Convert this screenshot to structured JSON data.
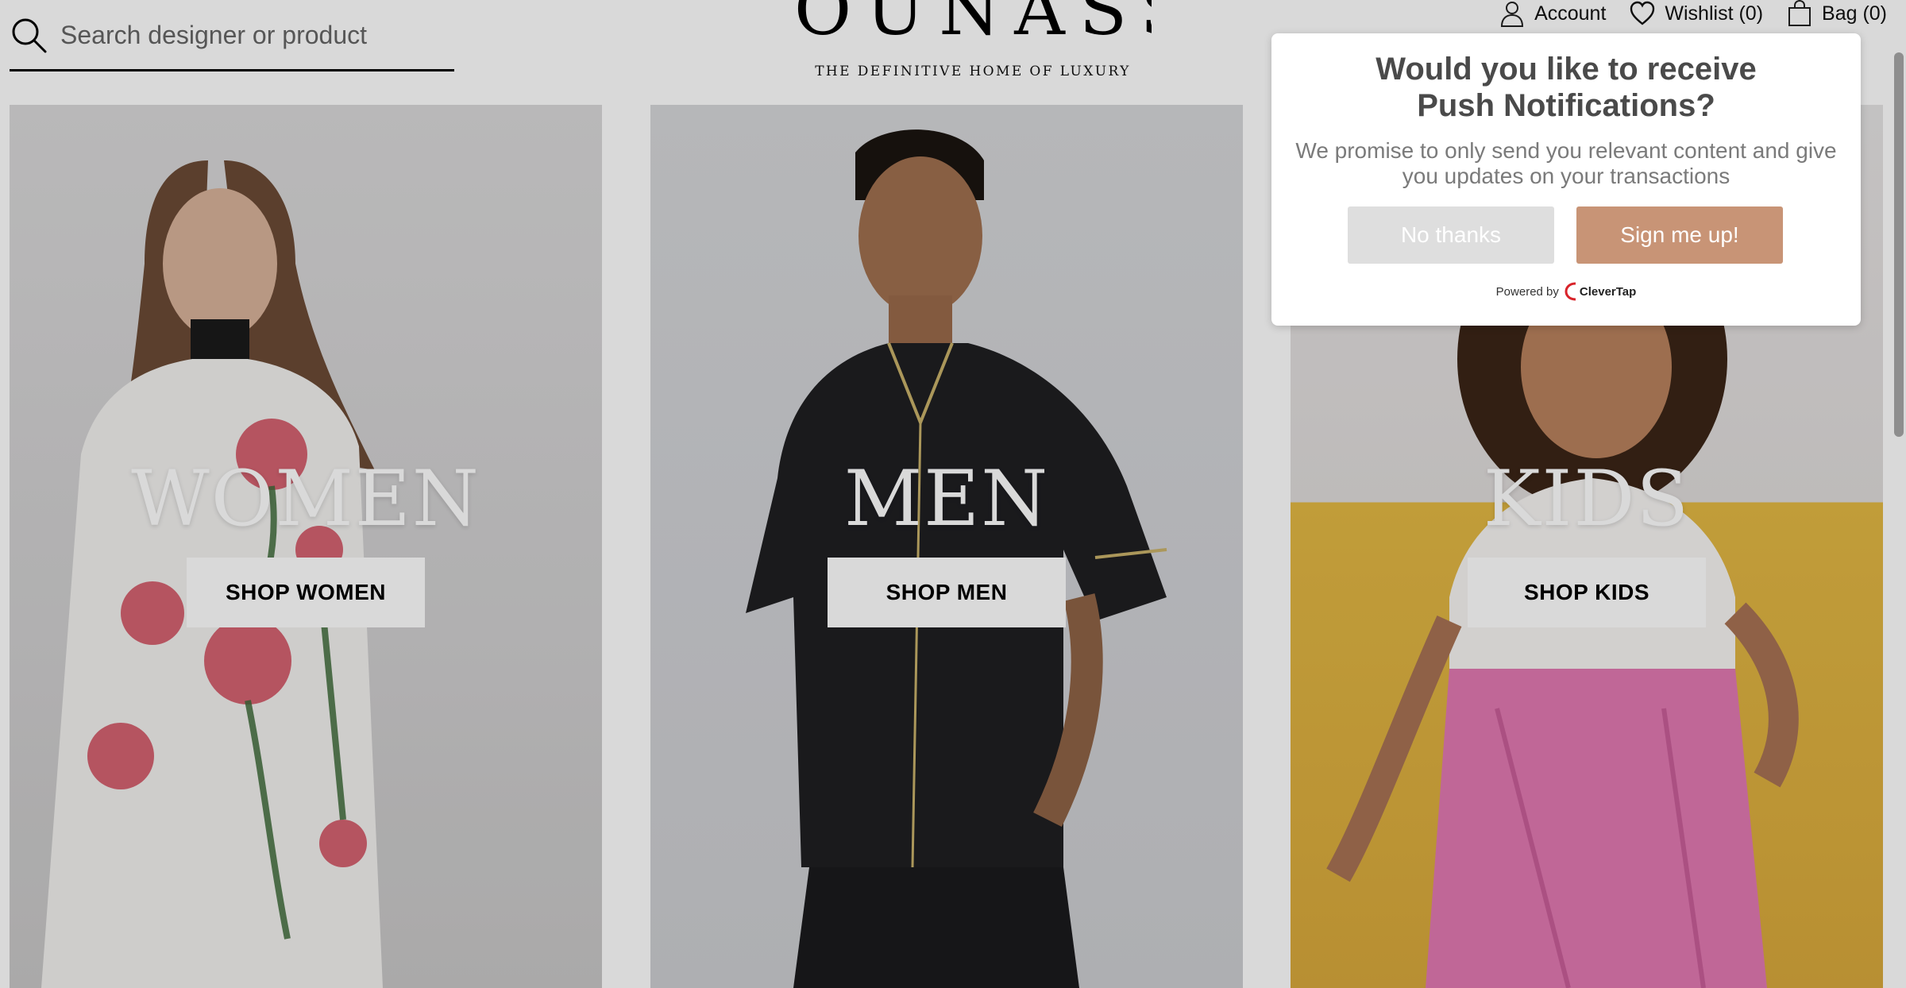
{
  "search": {
    "placeholder": "Search designer or product"
  },
  "brand": {
    "logo_text": "OUNASS",
    "tagline": "THE DEFINITIVE HOME OF LUXURY"
  },
  "nav": {
    "account_label": "Account",
    "wishlist_label": "Wishlist (0)",
    "bag_label": "Bag (0)"
  },
  "categories": [
    {
      "title": "WOMEN",
      "button_label": "SHOP WOMEN"
    },
    {
      "title": "MEN",
      "button_label": "SHOP MEN"
    },
    {
      "title": "KIDS",
      "button_label": "SHOP KIDS"
    }
  ],
  "push_modal": {
    "title_line1": "Would you like to receive",
    "title_line2": "Push Notifications?",
    "body": "We promise to only send you relevant content and give you updates on your transactions",
    "no_label": "No thanks",
    "yes_label": "Sign me up!",
    "powered_label": "Powered by",
    "provider": "CleverTap"
  },
  "colors": {
    "accent": "#c89476",
    "modal_title": "#4a4a4a",
    "modal_text": "#7a7a7a",
    "no_button": "#dedede"
  }
}
